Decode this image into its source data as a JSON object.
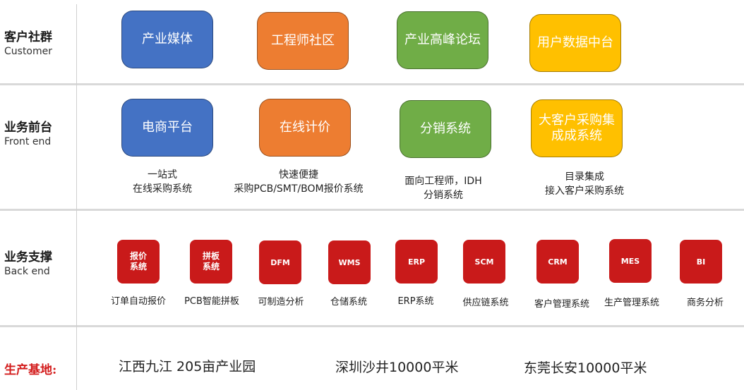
{
  "rows": [
    {
      "cn": "客户社群",
      "en": "Customer"
    },
    {
      "cn": "业务前台",
      "en": "Front end"
    },
    {
      "cn": "业务支撑",
      "en": "Back end"
    }
  ],
  "customer_boxes": [
    {
      "label": "产业媒体",
      "color": "#4472c4"
    },
    {
      "label": "工程师社区",
      "color": "#ed7d31"
    },
    {
      "label": "产业高峰论坛",
      "color": "#70ad47"
    },
    {
      "label": "用户数据中台",
      "color": "#ffc000"
    }
  ],
  "frontend_boxes": [
    {
      "label": "电商平台",
      "caption_1": "一站式",
      "caption_2": "在线采购系统",
      "color": "#4472c4"
    },
    {
      "label": "在线计价",
      "caption_1": "快速便捷",
      "caption_2": "采购PCB/SMT/BOM报价系统",
      "color": "#ed7d31"
    },
    {
      "label": "分销系统",
      "caption_1": "面向工程师，IDH",
      "caption_2": "分销系统",
      "color": "#70ad47"
    },
    {
      "label": "大客户采购集成成系统",
      "caption_1": "目录集成",
      "caption_2": "接入客户采购系统",
      "color": "#ffc000"
    }
  ],
  "backend_items": [
    {
      "icon": "报价\n系统",
      "label": "订单自动报价"
    },
    {
      "icon": "拼板\n系统",
      "label": "PCB智能拼板"
    },
    {
      "icon": "DFM",
      "label": "可制造分析"
    },
    {
      "icon": "WMS",
      "label": "仓储系统"
    },
    {
      "icon": "ERP",
      "label": "ERP系统"
    },
    {
      "icon": "SCM",
      "label": "供应链系统"
    },
    {
      "icon": "CRM",
      "label": "客户管理系统"
    },
    {
      "icon": "MES",
      "label": "生产管理系统"
    },
    {
      "icon": "BI",
      "label": "商务分析"
    }
  ],
  "production": {
    "title": "生产基地:",
    "sites": [
      "江西九江 205亩产业园",
      "深圳沙井10000平米",
      "东莞长安10000平米"
    ]
  },
  "colors": {
    "backend_icon": "#c91a1a",
    "production_title": "#d31b1b"
  }
}
